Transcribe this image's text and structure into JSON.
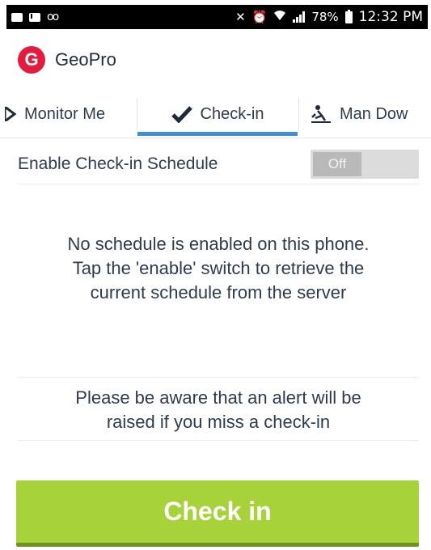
{
  "status_bar": {
    "battery": "78%",
    "time": "12:32 PM"
  },
  "app": {
    "title": "GeoPro",
    "logo_letter": "G",
    "brand_color": "#e31b3c"
  },
  "tabs": [
    {
      "label": "Monitor Me",
      "icon": "monitor-icon",
      "selected": false
    },
    {
      "label": "Check-in",
      "icon": "checkmark-icon",
      "selected": true
    },
    {
      "label": "Man Dow",
      "icon": "man-down-icon",
      "selected": false
    }
  ],
  "schedule": {
    "label": "Enable Check-in Schedule",
    "toggle_state": "Off"
  },
  "messages": {
    "no_schedule": [
      "No schedule is enabled on this phone.",
      "Tap the 'enable' switch to retrieve the",
      "current schedule from the server"
    ],
    "alert_notice": [
      "Please be aware that an alert will be",
      "raised if you miss a check-in"
    ]
  },
  "button": {
    "label": "Check in",
    "color": "#a7d23a"
  },
  "colors": {
    "tab_indicator": "#3f8ed6",
    "text": "#2e3b4e"
  }
}
